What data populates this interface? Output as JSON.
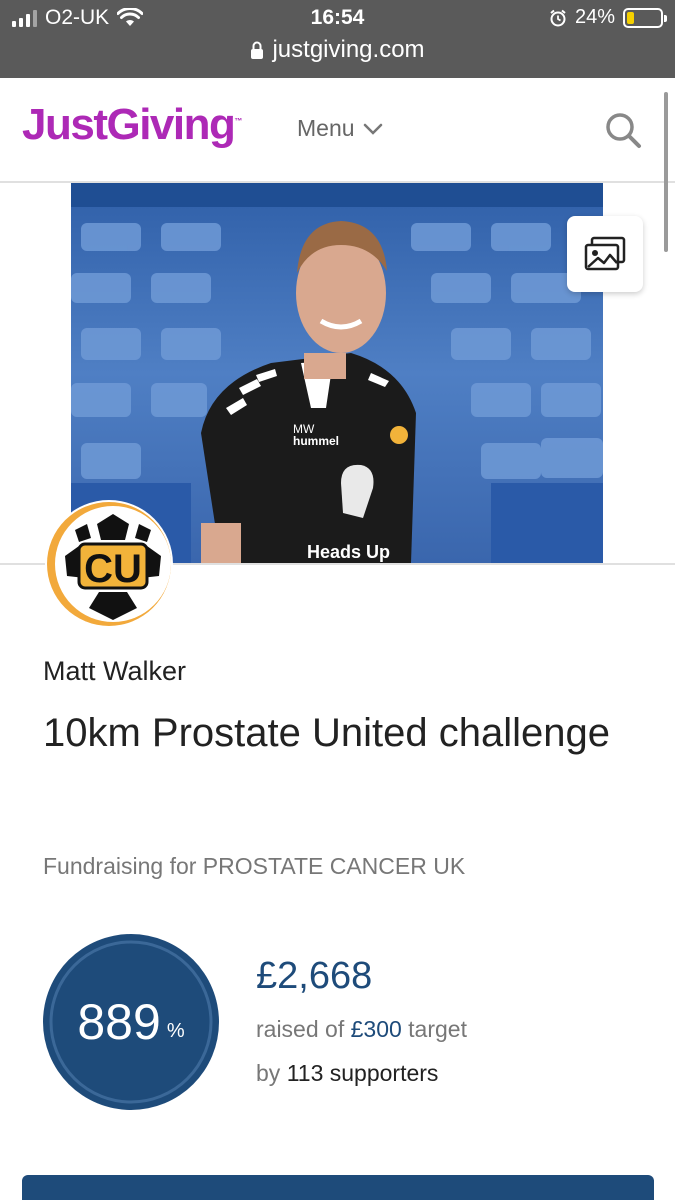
{
  "status_bar": {
    "carrier": "O2-UK",
    "time": "16:54",
    "battery_percent": "24%",
    "battery_level": 0.24,
    "url": "justgiving.com"
  },
  "header": {
    "logo": "JustGiving",
    "logo_tm": "™",
    "menu_label": "Menu"
  },
  "fundraiser": {
    "name": "Matt Walker",
    "title": "10km Prostate United challenge",
    "charity_line": "Fundraising for PROSTATE CANCER UK",
    "avatar_text": "CU",
    "shirt_initials": "MW",
    "shirt_brand": "hummel",
    "shirt_sponsor": "Heads Up"
  },
  "progress": {
    "percent": "889",
    "percent_sign": "%",
    "raised": "£2,668",
    "raised_prefix": "raised of",
    "target": "£300",
    "target_suffix": "target",
    "by_prefix": "by",
    "supporters": "113 supporters"
  },
  "colors": {
    "brand": "#ad29b6",
    "primary": "#1e4b7a"
  }
}
